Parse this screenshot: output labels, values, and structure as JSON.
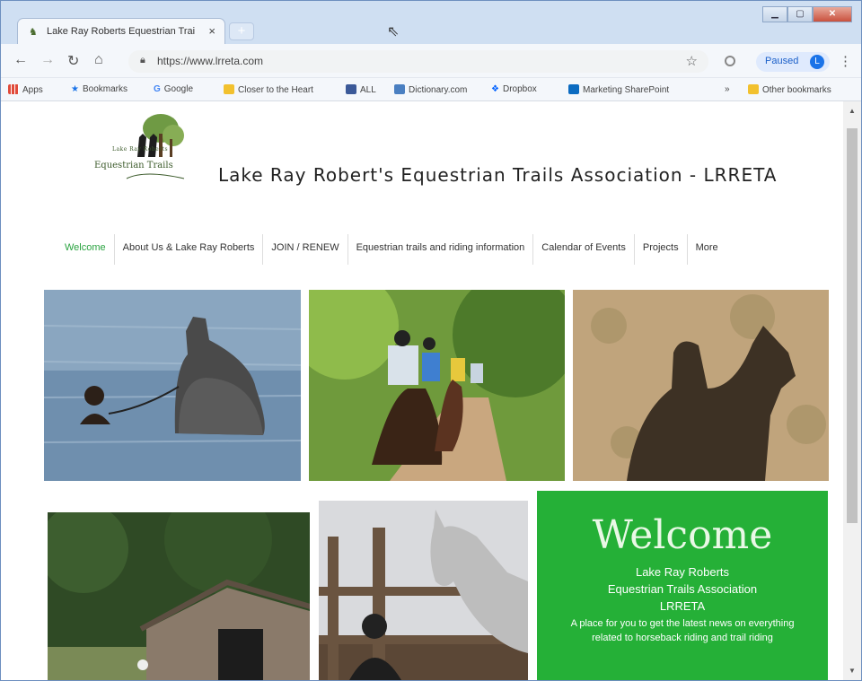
{
  "browser": {
    "tab_title": "Lake Ray Roberts Equestrian Trai",
    "tab_close": "×",
    "new_tab": "+",
    "url": "https://www.lrreta.com",
    "profile_label": "Paused",
    "profile_initial": "L",
    "bookmarks": [
      {
        "label": "Apps",
        "color": "#e04a3a"
      },
      {
        "label": "Bookmarks",
        "color": "#1a73e8"
      },
      {
        "label": "Google",
        "color": "#4285f4"
      },
      {
        "label": "Closer to the Heart",
        "color": "#f2c12e"
      },
      {
        "label": "ALL",
        "color": "#3b5998"
      },
      {
        "label": "Dictionary.com",
        "color": "#4a7fc1"
      },
      {
        "label": "Dropbox",
        "color": "#0061fe"
      },
      {
        "label": "Marketing SharePoint",
        "color": "#0b6bc1"
      }
    ],
    "bookmarks_more": "»",
    "other_bookmarks": "Other bookmarks"
  },
  "site": {
    "logo_line1": "Lake Ray Roberts",
    "logo_line2": "Equestrian Trails",
    "title": "Lake Ray Robert's Equestrian Trails Association - LRRETA",
    "nav": [
      {
        "label": "Welcome",
        "active": true
      },
      {
        "label": "About Us & Lake Ray Roberts"
      },
      {
        "label": "JOIN / RENEW"
      },
      {
        "label": "Equestrian trails and riding information"
      },
      {
        "label": "Calendar of Events"
      },
      {
        "label": "Projects"
      },
      {
        "label": "More"
      }
    ],
    "welcome": {
      "heading": "Welcome",
      "line1": "Lake Ray Roberts",
      "line2": "Equestrian Trails Association",
      "line3": "LRRETA",
      "tagline": "A place for you to get the latest news on everything related to horseback riding and trail riding"
    },
    "colors": {
      "accent_green": "#25b037",
      "nav_active": "#2aa340"
    }
  }
}
